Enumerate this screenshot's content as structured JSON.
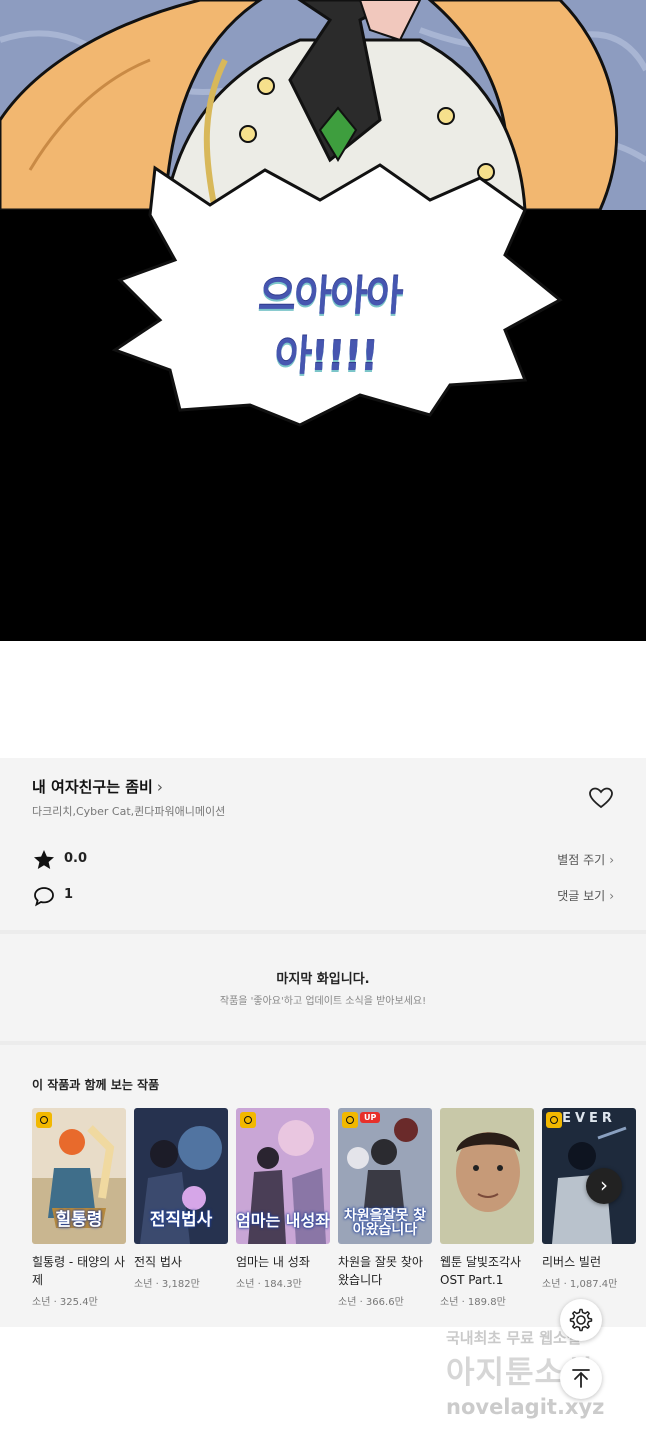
{
  "comic": {
    "sfx_text": "으아아아아!!!!"
  },
  "series": {
    "title": "내 여자친구는 좀비",
    "authors": "다크리치,Cyber Cat,퀸다파워애니메이션",
    "rating": "0.0",
    "rate_label": "별점 주기",
    "comments": "1",
    "comments_label": "댓글 보기"
  },
  "last_episode": {
    "title": "마지막 화입니다.",
    "subtitle": "작품을 '좋아요'하고 업데이트 소식을 받아보세요!"
  },
  "recommendations": {
    "heading": "이 작품과 함께 보는 작품",
    "items": [
      {
        "name": "힐통령 - 태양의 사제",
        "meta": "소년 · 325.4만",
        "cover_text": "힐통령",
        "badge": "clock"
      },
      {
        "name": "전직 법사",
        "meta": "소년 · 3,182만",
        "cover_text": "전직법사",
        "badge": "none"
      },
      {
        "name": "엄마는 내 성좌",
        "meta": "소년 · 184.3만",
        "cover_text": "엄마는 내성좌",
        "badge": "clock"
      },
      {
        "name": "차원을 잘못 찾아왔습니다",
        "meta": "소년 · 366.6만",
        "cover_text": "차원을잘못 찾아왔습니다",
        "badge": "clock",
        "badge2": "UP"
      },
      {
        "name": "웹툰 달빛조각사 OST Part.1",
        "meta": "소년 · 189.8만",
        "cover_text": "",
        "badge": "none"
      },
      {
        "name": "리버스 빌런",
        "meta": "소년 · 1,087.4만",
        "cover_text": "EVER",
        "badge": "clock"
      }
    ]
  },
  "watermark": {
    "line1": "국내최초 무료 웹소설",
    "line2": "아지툰소설",
    "line3": "novelagit.xyz"
  },
  "colors": {
    "panel_bg": "#f4f4f4",
    "sfx": "#4656b0",
    "up_badge": "#e7302a",
    "clock_badge": "#f2b800"
  }
}
